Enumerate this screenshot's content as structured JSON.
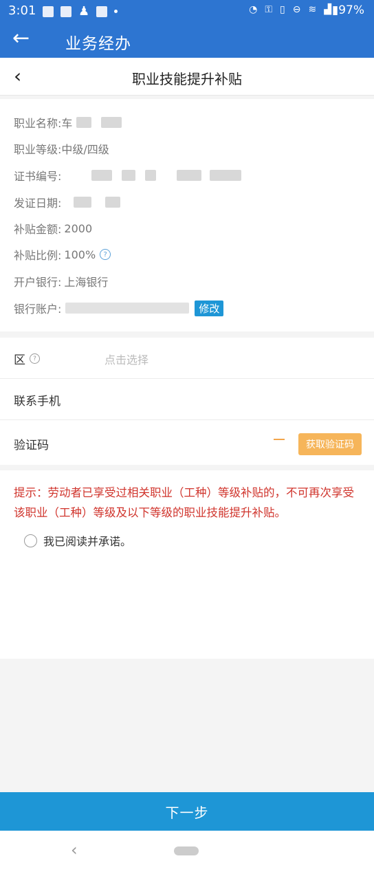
{
  "status_bar": {
    "time": "3:01",
    "battery": "97%"
  },
  "app_bar": {
    "title": "业务经办"
  },
  "page": {
    "title": "职业技能提升补贴"
  },
  "info": {
    "occupation_name_label": "职业名称:",
    "occupation_name_value": "车",
    "level_label": "职业等级:",
    "level_value": "中级/四级",
    "cert_no_label": "证书编号:",
    "issue_date_label": "发证日期:",
    "amount_label": "补贴金额:",
    "amount_value": "2000",
    "ratio_label": "补贴比例:",
    "ratio_value": "100%",
    "bank_label": "开户银行:",
    "bank_value": "上海银行",
    "account_label": "银行账户:",
    "edit_label": "修改"
  },
  "form": {
    "district_label": "区",
    "district_placeholder": "点击选择",
    "phone_label": "联系手机",
    "code_label": "验证码",
    "code_button": "获取验证码"
  },
  "notice": {
    "text": "提示：劳动者已享受过相关职业（工种）等级补贴的，不可再次享受该职业（工种）等级及以下等级的职业技能提升补贴。",
    "promise": "我已阅读并承诺。"
  },
  "footer": {
    "next_label": "下一步"
  },
  "colors": {
    "primary": "#2d75d1",
    "button": "#1e96d6",
    "warning": "#d0342c",
    "code_button": "#f6b55a"
  }
}
